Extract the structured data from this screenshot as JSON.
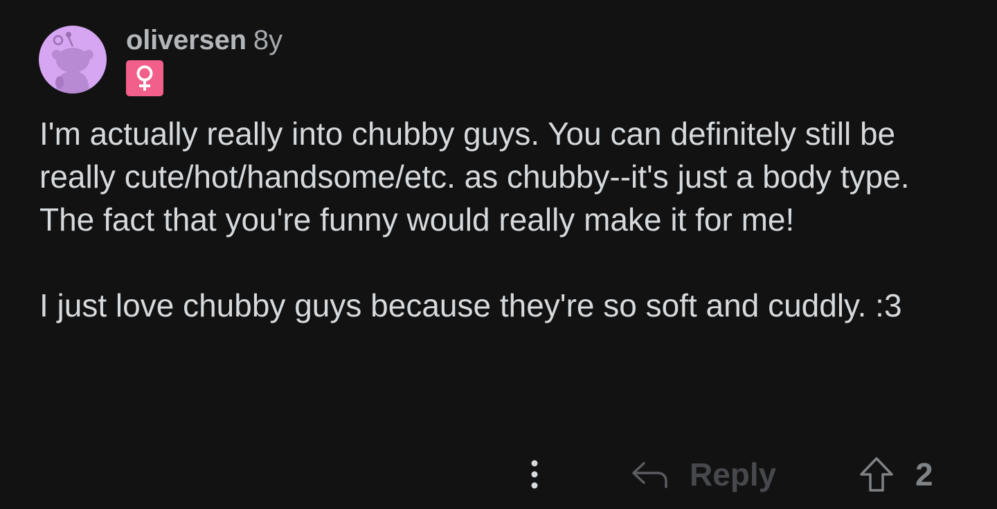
{
  "comment": {
    "author": "oliversen",
    "age": "8y",
    "flair_icon": "female-sign-icon",
    "avatar_color": "#d6a6f2",
    "flair_color": "#f25f8a",
    "paragraphs": [
      "I'm actually really into chubby guys. You can definitely still be really cute/hot/handsome/etc. as chubby--it's just a body type. The fact that you're funny would really make it for me!",
      "I just love chubby guys because they're so soft and cuddly. :3"
    ]
  },
  "actions": {
    "more_icon": "more-vertical-icon",
    "reply_icon": "reply-arrow-icon",
    "reply_label": "Reply",
    "upvote_icon": "upvote-arrow-icon",
    "vote_count": "2"
  }
}
